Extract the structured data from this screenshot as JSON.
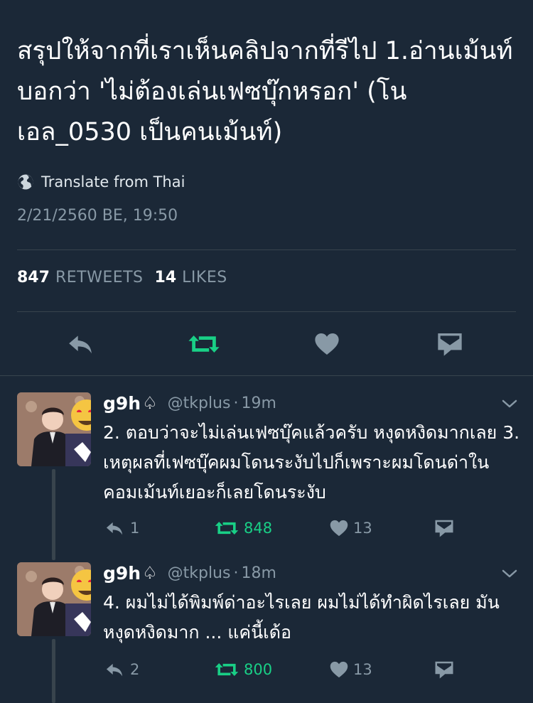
{
  "main_tweet": {
    "text": "สรุปให้จากที่เราเห็นคลิปจากที่รีไป 1.อ่านเม้นท์บอกว่า 'ไม่ต้องเล่นเฟซบุ๊กหรอก' (โนเอล_0530 เป็นคนเม้นท์)",
    "translate_label": "Translate from Thai",
    "timestamp": "2/21/2560 BE, 19:50",
    "retweet_count": "847",
    "retweet_label": "RETWEETS",
    "like_count": "14",
    "like_label": "LIKES"
  },
  "replies": [
    {
      "display_name": "g9h",
      "handle": "@tkplus",
      "time": "19m",
      "text": "2. ตอบว่าจะไม่เล่นเฟซบุ๊คแล้วครับ หงุดหงิดมากเลย 3. เหตุผลที่เฟซบุ๊คผมโดนระงับไปก็เพราะผมโดนด่าในคอมเม้นท์เยอะก็เลยโดนระงับ",
      "reply_count": "1",
      "retweet_count": "848",
      "like_count": "13"
    },
    {
      "display_name": "g9h",
      "handle": "@tkplus",
      "time": "18m",
      "text": "4. ผมไม่ได้พิมพ์ด่าอะไรเลย ผมไม่ได้ทำผิดไรเลย มันหงุดหงิดมาก ... แค่นี้เด้อ",
      "reply_count": "2",
      "retweet_count": "800",
      "like_count": "13"
    }
  ],
  "colors": {
    "background": "#1b2837",
    "muted": "#8899a6",
    "divider": "#38444d",
    "retweet_green": "#19cf86",
    "icon_gray": "#8899a6"
  },
  "icons": {
    "reply": "reply-icon",
    "retweet": "retweet-icon",
    "like": "heart-icon",
    "dm": "envelope-icon",
    "translate": "globe-icon",
    "more": "chevron-down-icon",
    "badge": "spade-icon"
  }
}
